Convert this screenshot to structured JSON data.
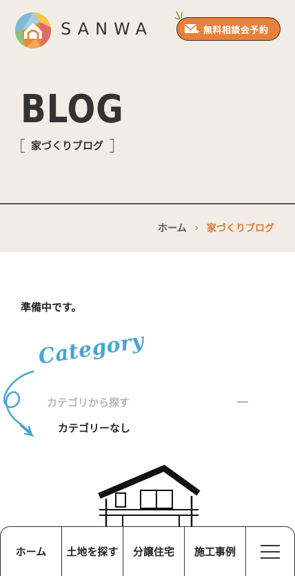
{
  "header": {
    "brand": "SANWA",
    "cta_label": "無料相談会予約"
  },
  "hero": {
    "title": "BLOG",
    "subtitle": "家づくりブログ"
  },
  "breadcrumb": {
    "home": "ホーム",
    "separator": "›",
    "current": "家づくりブログ"
  },
  "main": {
    "notice": "準備中です。"
  },
  "category": {
    "heading": "Category",
    "search_label": "カテゴリから探す",
    "empty": "カテゴリーなし"
  },
  "tabbar": {
    "items": [
      {
        "label": "ホーム"
      },
      {
        "label": "土地を探す"
      },
      {
        "label": "分譲住宅"
      },
      {
        "label": "施工事例"
      }
    ],
    "menu_icon": "hamburger-menu-icon"
  },
  "colors": {
    "accent": "#e9803a",
    "background": "#f1ede6",
    "category_blue": "#4aa5d0"
  }
}
